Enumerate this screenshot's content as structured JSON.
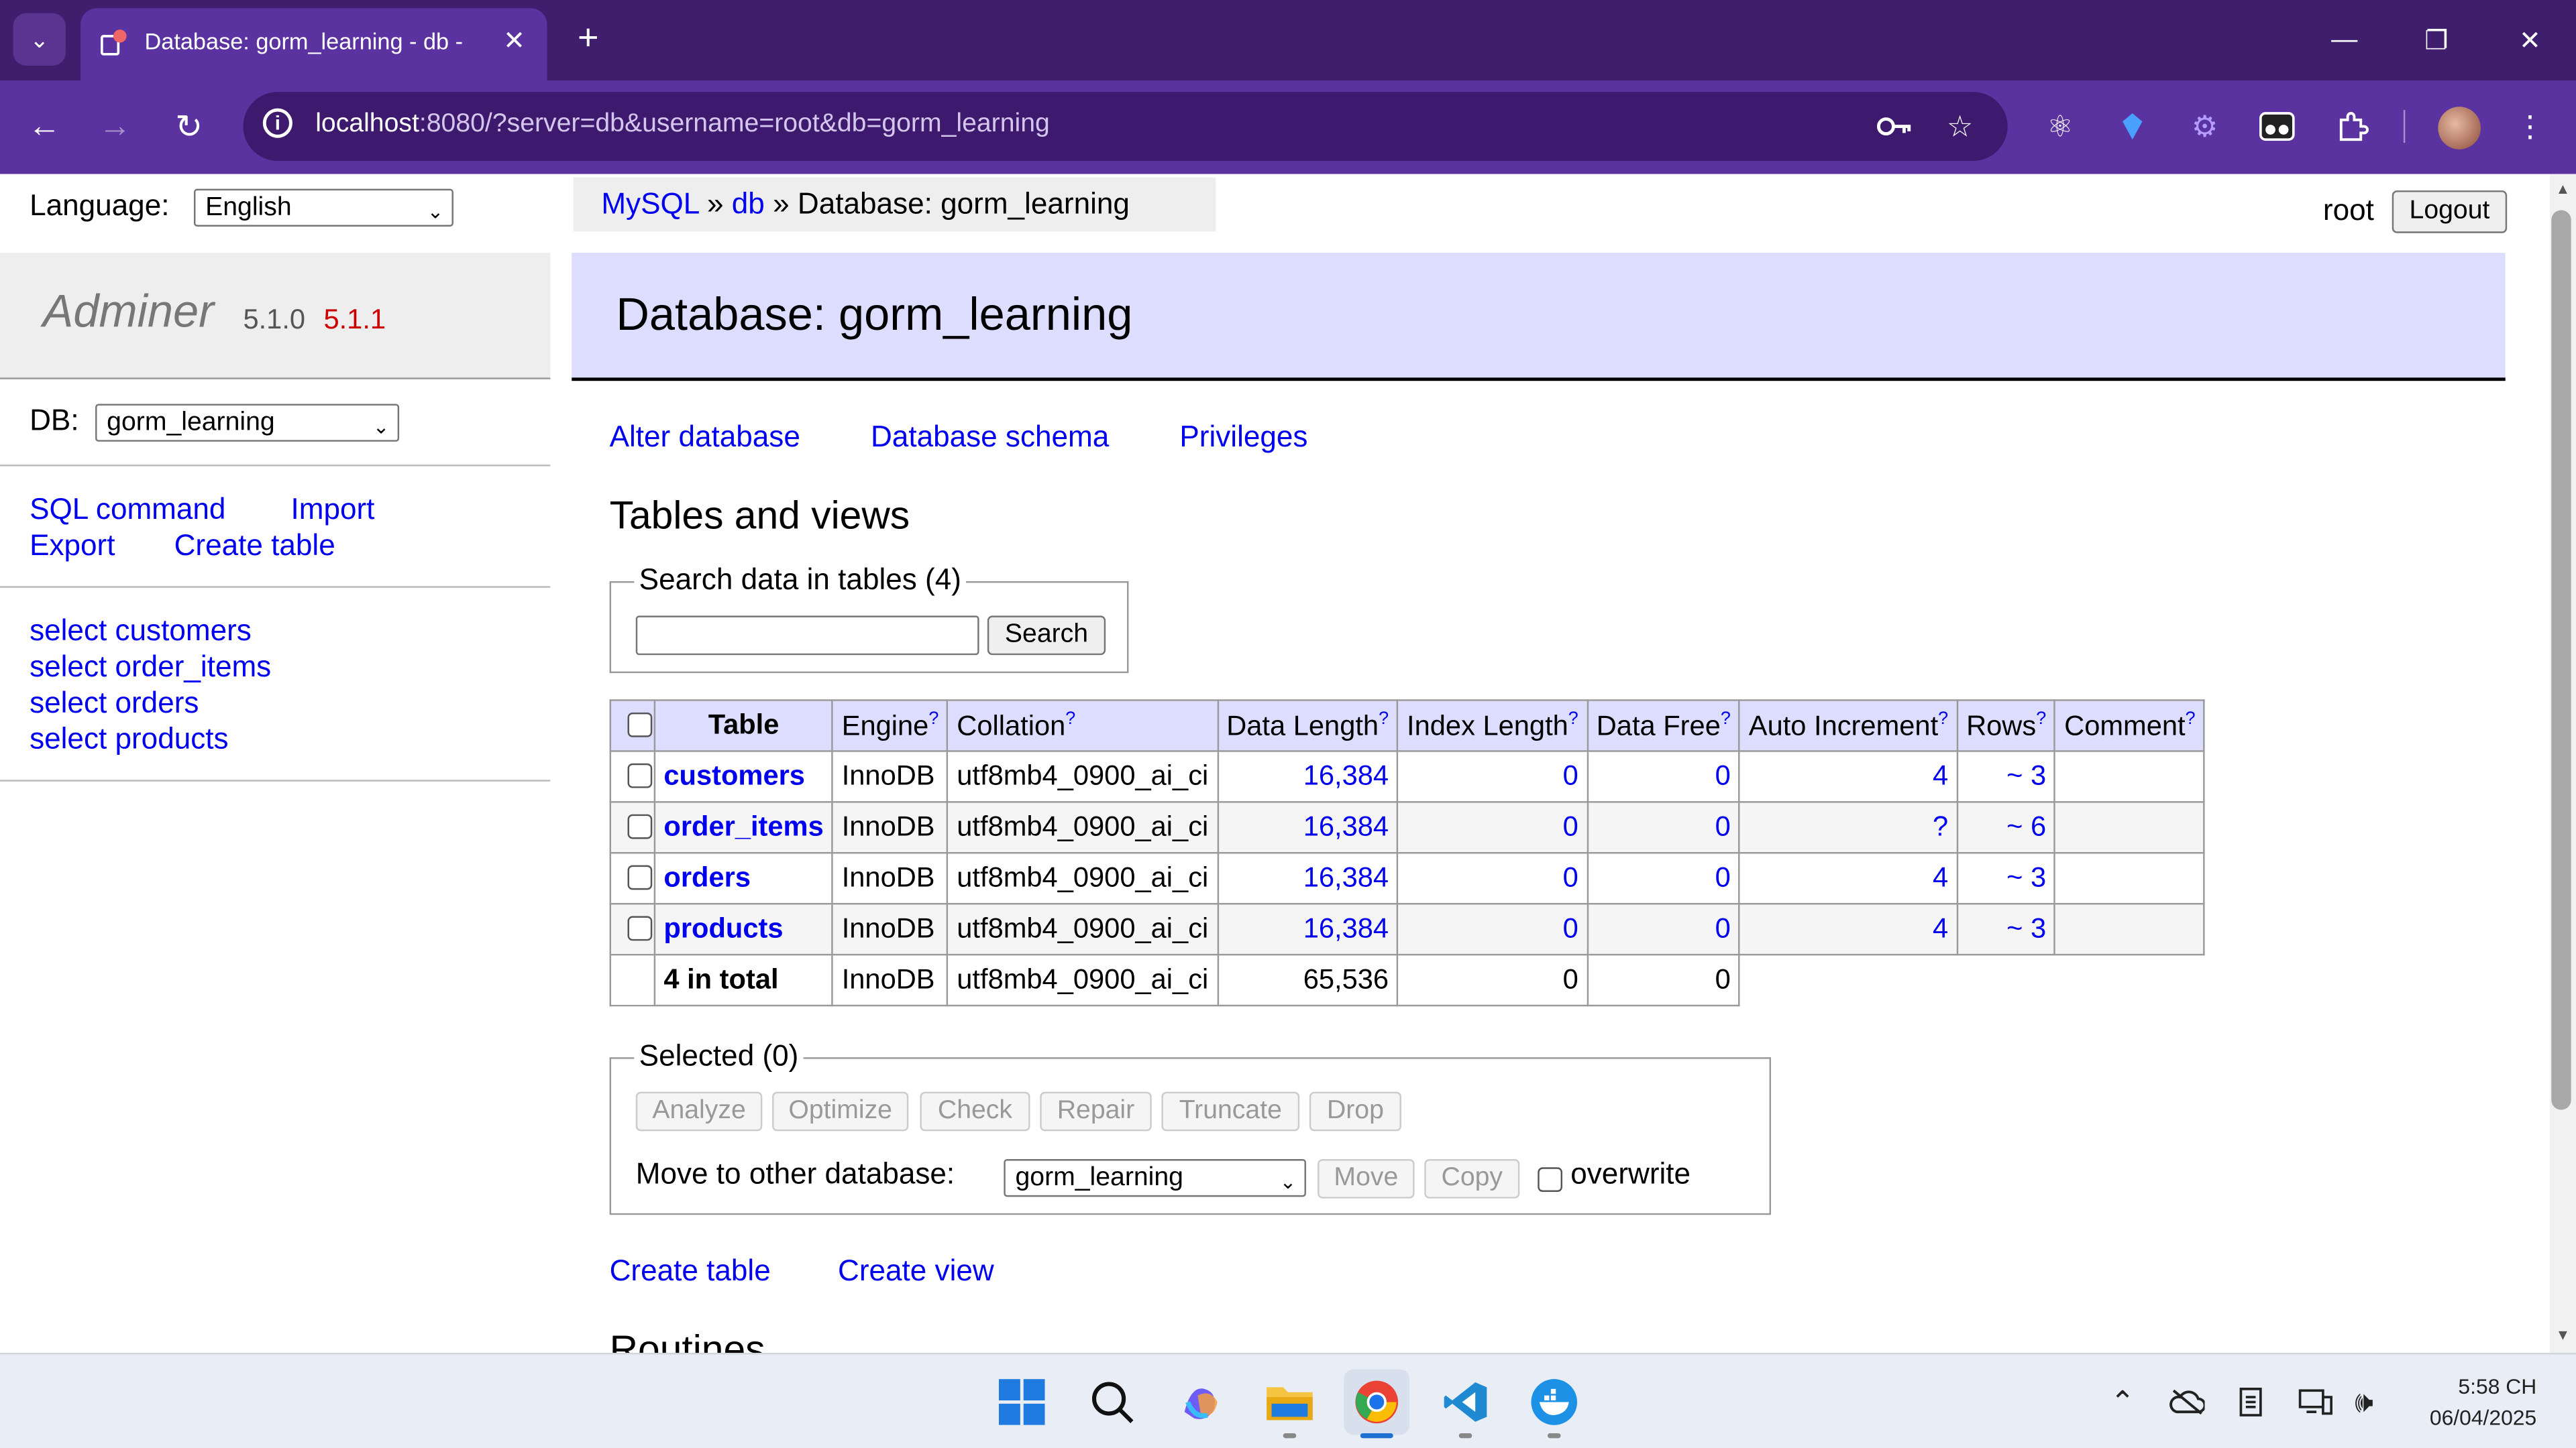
{
  "browser": {
    "tab_title": "Database: gorm_learning - db -",
    "url_host": "localhost",
    "url_rest": ":8080/?server=db&username=root&db=gorm_learning"
  },
  "sidebar": {
    "language_label": "Language:",
    "language_value": "English",
    "brand": "Adminer",
    "version": "5.1.0",
    "new_version": "5.1.1",
    "db_label": "DB:",
    "db_value": "gorm_learning",
    "commands": [
      "SQL command",
      "Import",
      "Export",
      "Create table"
    ],
    "tables": [
      "select customers",
      "select order_items",
      "select orders",
      "select products"
    ]
  },
  "header": {
    "crumb_mysql": "MySQL",
    "crumb_sep": "»",
    "crumb_db": "db",
    "crumb_current": "Database: gorm_learning",
    "user": "root",
    "logout": "Logout"
  },
  "main": {
    "title": "Database: gorm_learning",
    "links": [
      "Alter database",
      "Database schema",
      "Privileges"
    ],
    "section_title": "Tables and views",
    "search_legend": "Search data in tables (4)",
    "search_button": "Search",
    "columns": [
      "Table",
      "Engine",
      "Collation",
      "Data Length",
      "Index Length",
      "Data Free",
      "Auto Increment",
      "Rows",
      "Comment"
    ],
    "help_mark": "?",
    "rows": [
      {
        "name": "customers",
        "engine": "InnoDB",
        "collation": "utf8mb4_0900_ai_ci",
        "data_length": "16,384",
        "index_length": "0",
        "data_free": "0",
        "auto_increment": "4",
        "rows": "~ 3",
        "comment": ""
      },
      {
        "name": "order_items",
        "engine": "InnoDB",
        "collation": "utf8mb4_0900_ai_ci",
        "data_length": "16,384",
        "index_length": "0",
        "data_free": "0",
        "auto_increment": "?",
        "rows": "~ 6",
        "comment": ""
      },
      {
        "name": "orders",
        "engine": "InnoDB",
        "collation": "utf8mb4_0900_ai_ci",
        "data_length": "16,384",
        "index_length": "0",
        "data_free": "0",
        "auto_increment": "4",
        "rows": "~ 3",
        "comment": ""
      },
      {
        "name": "products",
        "engine": "InnoDB",
        "collation": "utf8mb4_0900_ai_ci",
        "data_length": "16,384",
        "index_length": "0",
        "data_free": "0",
        "auto_increment": "4",
        "rows": "~ 3",
        "comment": ""
      }
    ],
    "total": {
      "name": "4 in total",
      "engine": "InnoDB",
      "collation": "utf8mb4_0900_ai_ci",
      "data_length": "65,536",
      "index_length": "0",
      "data_free": "0"
    },
    "selected_legend": "Selected (0)",
    "actions": [
      "Analyze",
      "Optimize",
      "Check",
      "Repair",
      "Truncate",
      "Drop"
    ],
    "move_label": "Move to other database:",
    "move_db": "gorm_learning",
    "move_button": "Move",
    "copy_button": "Copy",
    "overwrite_label": "overwrite",
    "bottom_links": [
      "Create table",
      "Create view"
    ],
    "routines_title": "Routines"
  },
  "taskbar": {
    "time": "5:58 CH",
    "date": "06/04/2025"
  },
  "colors": {
    "titlebar": "#3f1e6d",
    "toolbar": "#5b33a0",
    "header_bg": "#ddf",
    "link": "#0000ee",
    "new_version": "#cc0000"
  }
}
